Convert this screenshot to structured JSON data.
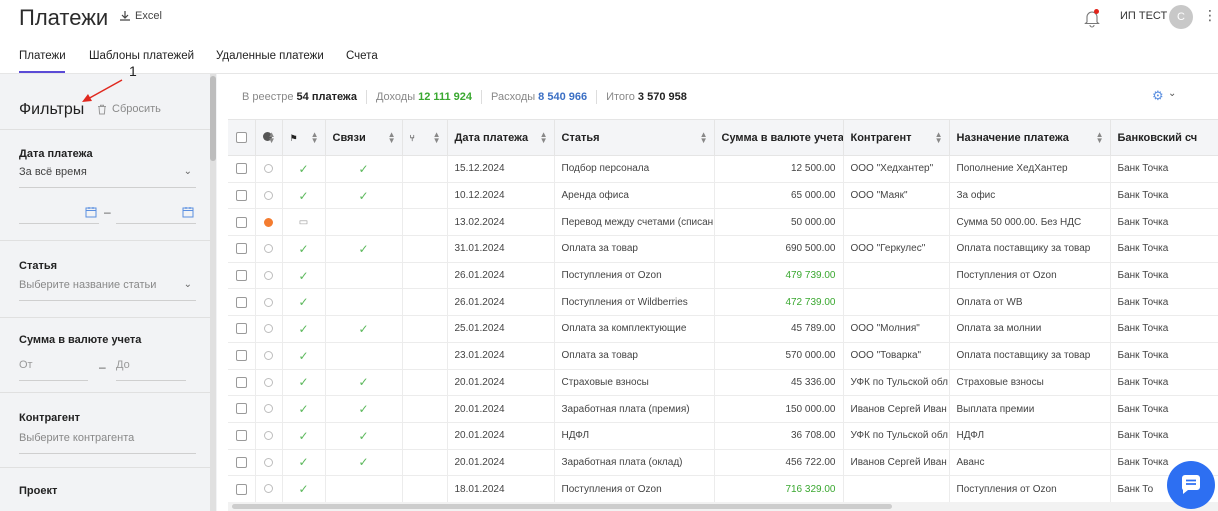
{
  "header": {
    "title": "Платежи",
    "excel_label": "Excel",
    "user_name": "ИП ТЕСТ",
    "avatar_initial": "С"
  },
  "tabs": [
    "Платежи",
    "Шаблоны платежей",
    "Удаленные платежи",
    "Счета"
  ],
  "filters": {
    "title": "Фильтры",
    "reset_label": "Сбросить",
    "date": {
      "label": "Дата платежа",
      "value": "За всё время"
    },
    "article": {
      "label": "Статья",
      "placeholder": "Выберите название статьи"
    },
    "amount": {
      "label": "Сумма в валюте учета",
      "from_placeholder": "От",
      "to_placeholder": "До"
    },
    "counterparty": {
      "label": "Контрагент",
      "placeholder": "Выберите контрагента"
    },
    "project": {
      "label": "Проект"
    }
  },
  "summary": {
    "registry_label": "В реестре",
    "registry_value": "54 платежа",
    "income_label": "Доходы",
    "income_value": "12 111 924",
    "expense_label": "Расходы",
    "expense_value": "8 540 966",
    "total_label": "Итого",
    "total_value": "3 570 958"
  },
  "table": {
    "columns": [
      "Связи",
      "Дата платежа",
      "Статья",
      "Сумма в валюте учета",
      "Контрагент",
      "Назначение платежа",
      "Банковский сч"
    ],
    "rows": [
      {
        "status": "empty",
        "check": true,
        "link": true,
        "date": "15.12.2024",
        "article": "Подбор персонала",
        "amount": "12 500.00",
        "type": "expense",
        "cp": "ООО \"Хедхантер\"",
        "purpose": "Пополнение ХедХантер",
        "bank": "Банк Точка"
      },
      {
        "status": "empty",
        "check": true,
        "link": true,
        "date": "10.12.2024",
        "article": "Аренда офиса",
        "amount": "65 000.00",
        "type": "expense",
        "cp": "ООО \"Маяк\"",
        "purpose": "За офис",
        "bank": "Банк Точка"
      },
      {
        "status": "orange",
        "check": false,
        "link": false,
        "date": "13.02.2024",
        "article": "Перевод между счетами (списан",
        "amount": "50 000.00",
        "type": "expense",
        "cp": "",
        "purpose": "Сумма 50 000.00. Без НДС",
        "bank": "Банк Точка"
      },
      {
        "status": "empty",
        "check": true,
        "link": true,
        "date": "31.01.2024",
        "article": "Оплата за товар",
        "amount": "690 500.00",
        "type": "expense",
        "cp": "ООО \"Геркулес\"",
        "purpose": "Оплата поставщику за товар",
        "bank": "Банк Точка"
      },
      {
        "status": "empty",
        "check": true,
        "link": false,
        "date": "26.01.2024",
        "article": "Поступления от Ozon",
        "amount": "479 739.00",
        "type": "income",
        "cp": "",
        "purpose": "Поступления от Ozon",
        "bank": "Банк Точка"
      },
      {
        "status": "empty",
        "check": true,
        "link": false,
        "date": "26.01.2024",
        "article": "Поступления от Wildberries",
        "amount": "472 739.00",
        "type": "income",
        "cp": "",
        "purpose": "Оплата от WB",
        "bank": "Банк Точка"
      },
      {
        "status": "empty",
        "check": true,
        "link": true,
        "date": "25.01.2024",
        "article": "Оплата за комплектующие",
        "amount": "45 789.00",
        "type": "expense",
        "cp": "ООО \"Молния\"",
        "purpose": "Оплата за молнии",
        "bank": "Банк Точка"
      },
      {
        "status": "empty",
        "check": true,
        "link": false,
        "date": "23.01.2024",
        "article": "Оплата за товар",
        "amount": "570 000.00",
        "type": "expense",
        "cp": "ООО \"Товарка\"",
        "purpose": "Оплата поставщику за товар",
        "bank": "Банк Точка"
      },
      {
        "status": "empty",
        "check": true,
        "link": true,
        "date": "20.01.2024",
        "article": "Страховые взносы",
        "amount": "45 336.00",
        "type": "expense",
        "cp": "УФК по Тульской обл",
        "purpose": "Страховые взносы",
        "bank": "Банк Точка"
      },
      {
        "status": "empty",
        "check": true,
        "link": true,
        "date": "20.01.2024",
        "article": "Заработная плата (премия)",
        "amount": "150 000.00",
        "type": "expense",
        "cp": "Иванов Сергей Иван",
        "purpose": "Выплата премии",
        "bank": "Банк Точка"
      },
      {
        "status": "empty",
        "check": true,
        "link": true,
        "date": "20.01.2024",
        "article": "НДФЛ",
        "amount": "36 708.00",
        "type": "expense",
        "cp": "УФК по Тульской обл",
        "purpose": "НДФЛ",
        "bank": "Банк Точка"
      },
      {
        "status": "empty",
        "check": true,
        "link": true,
        "date": "20.01.2024",
        "article": "Заработная плата (оклад)",
        "amount": "456 722.00",
        "type": "expense",
        "cp": "Иванов Сергей Иван",
        "purpose": "Аванс",
        "bank": "Банк Точка"
      },
      {
        "status": "empty",
        "check": true,
        "link": false,
        "date": "18.01.2024",
        "article": "Поступления от Ozon",
        "amount": "716 329.00",
        "type": "income",
        "cp": "",
        "purpose": "Поступления от Ozon",
        "bank": "Банк То"
      }
    ]
  },
  "annotation_number": "1",
  "colors": {
    "accent": "#5b4bd6",
    "income": "#3aa830",
    "expense": "#3b6fc4",
    "chat": "#2d6ff2",
    "orange": "#f47c30"
  }
}
